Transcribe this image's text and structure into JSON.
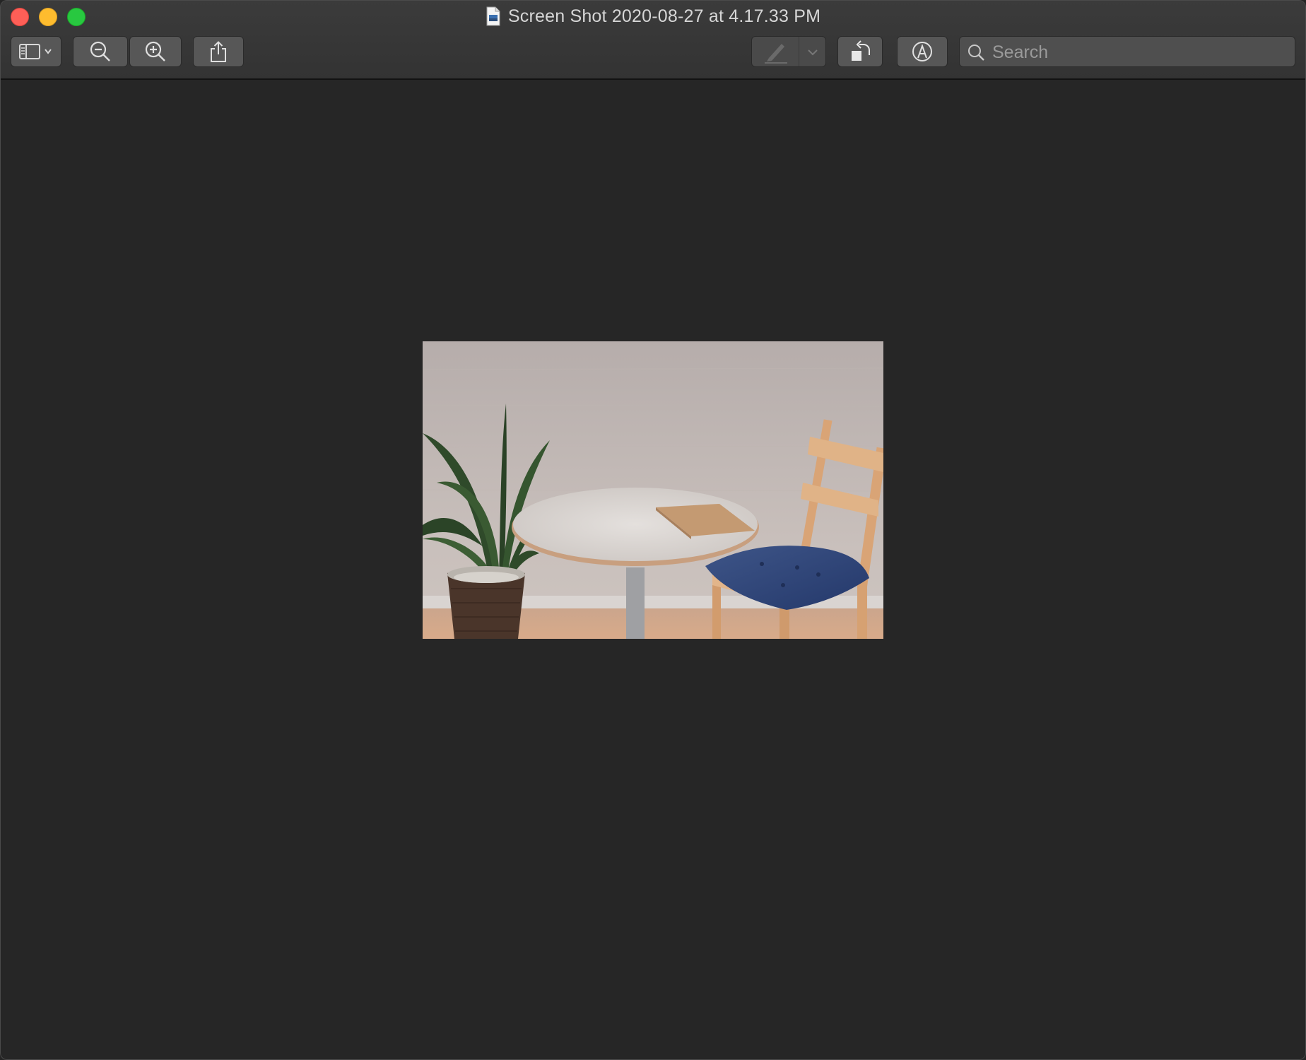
{
  "window": {
    "title": "Screen Shot 2020-08-27 at 4.17.33 PM"
  },
  "toolbar": {
    "sidebar_button_icon": "sidebar-icon",
    "zoom_out_icon": "zoom-out-icon",
    "zoom_in_icon": "zoom-in-icon",
    "share_icon": "share-icon",
    "highlight_icon": "pen-icon",
    "rotate_icon": "rotate-left-icon",
    "markup_icon": "markup-icon",
    "search": {
      "placeholder": "Search",
      "value": ""
    }
  },
  "colors": {
    "close": "#fe5f57",
    "minimize": "#febc2e",
    "maximize": "#28c840",
    "background": "#262626"
  }
}
